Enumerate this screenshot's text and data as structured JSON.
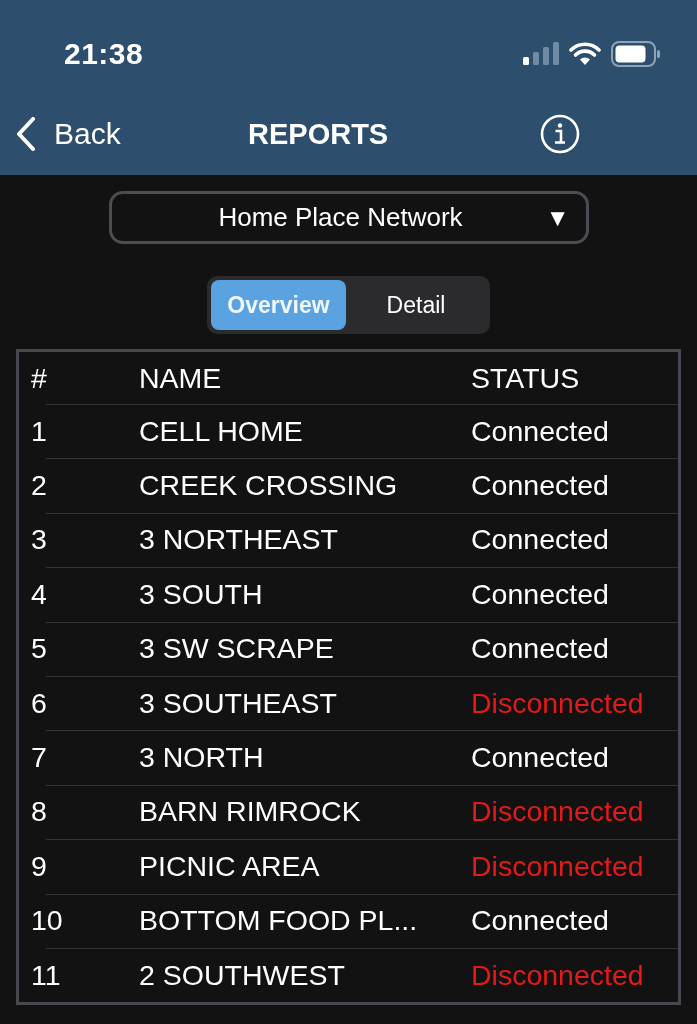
{
  "status_bar": {
    "time": "21:38"
  },
  "nav": {
    "back": "Back",
    "title": "REPORTS"
  },
  "network_picker": {
    "value": "Home Place Network",
    "arrow": "▼"
  },
  "segments": [
    {
      "label": "Overview",
      "selected": true
    },
    {
      "label": "Detail",
      "selected": false
    }
  ],
  "table": {
    "columns": [
      "#",
      "NAME",
      "STATUS"
    ],
    "rows": [
      {
        "number": "1",
        "name": "CELL HOME",
        "status": "Connected",
        "connected": true
      },
      {
        "number": "2",
        "name": "CREEK CROSSING",
        "status": "Connected",
        "connected": true
      },
      {
        "number": "3",
        "name": "3 NORTHEAST",
        "status": "Connected",
        "connected": true
      },
      {
        "number": "4",
        "name": "3 SOUTH",
        "status": "Connected",
        "connected": true
      },
      {
        "number": "5",
        "name": "3 SW SCRAPE",
        "status": "Connected",
        "connected": true
      },
      {
        "number": "6",
        "name": "3 SOUTHEAST",
        "status": "Disconnected",
        "connected": false
      },
      {
        "number": "7",
        "name": "3 NORTH",
        "status": "Connected",
        "connected": true
      },
      {
        "number": "8",
        "name": "BARN RIMROCK",
        "status": "Disconnected",
        "connected": false
      },
      {
        "number": "9",
        "name": "PICNIC AREA",
        "status": "Disconnected",
        "connected": false
      },
      {
        "number": "10",
        "name": "BOTTOM FOOD PL...",
        "status": "Connected",
        "connected": true
      },
      {
        "number": "11",
        "name": "2 SOUTHWEST",
        "status": "Disconnected",
        "connected": false
      }
    ]
  }
}
